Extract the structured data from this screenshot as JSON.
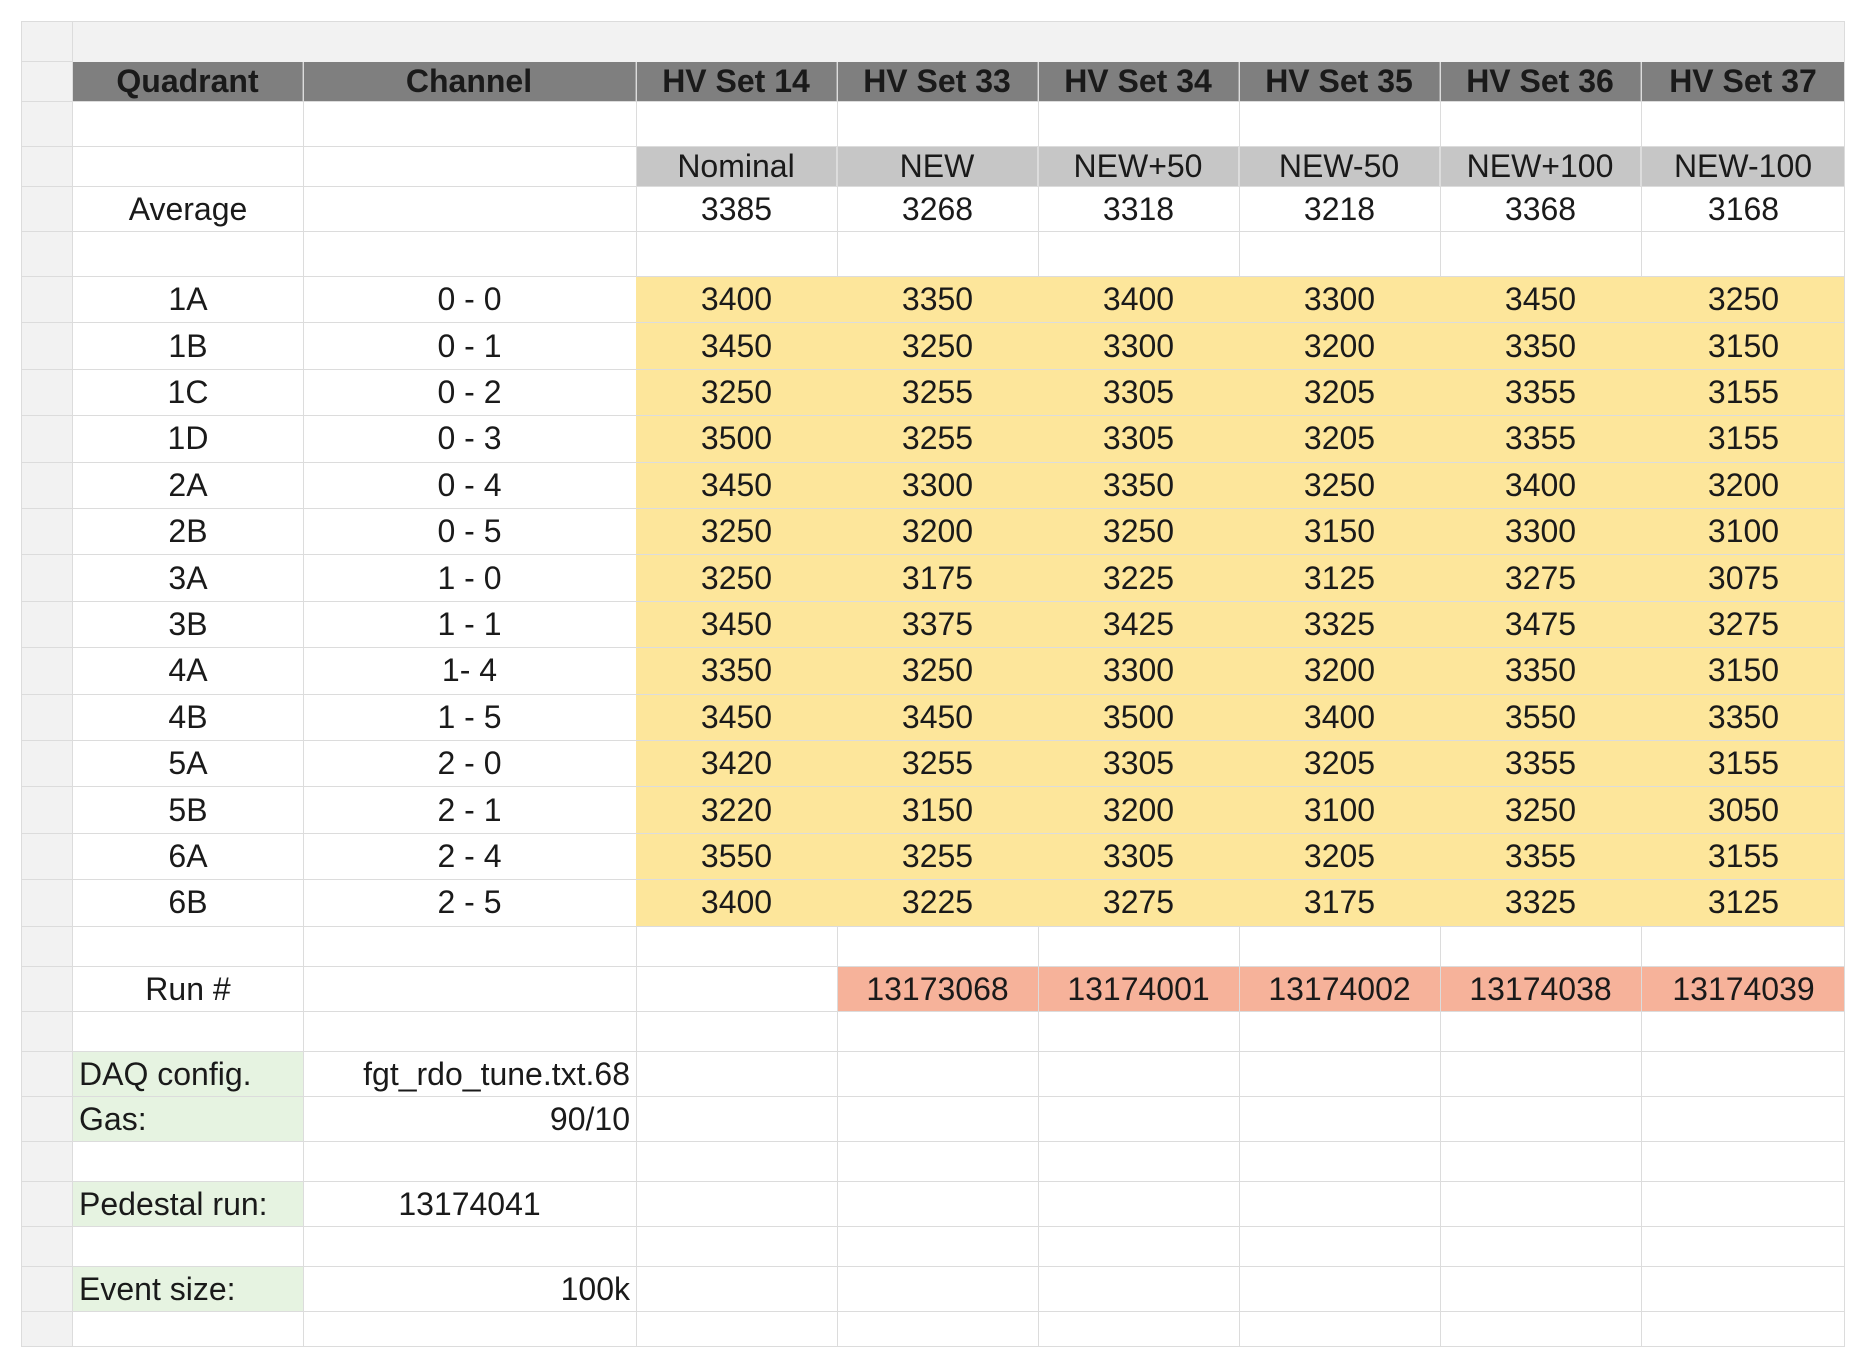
{
  "headers": [
    "Quadrant",
    "Channel",
    "HV Set 14",
    "HV Set 33",
    "HV Set 34",
    "HV Set 35",
    "HV Set 36",
    "HV Set 37"
  ],
  "subheaders": [
    "Nominal",
    "NEW",
    "NEW+50",
    "NEW-50",
    "NEW+100",
    "NEW-100"
  ],
  "average": {
    "label": "Average",
    "values": [
      "3385",
      "3268",
      "3318",
      "3218",
      "3368",
      "3168"
    ]
  },
  "rows": [
    {
      "quadrant": "1A",
      "channel": "0 - 0",
      "values": [
        "3400",
        "3350",
        "3400",
        "3300",
        "3450",
        "3250"
      ]
    },
    {
      "quadrant": "1B",
      "channel": "0 - 1",
      "values": [
        "3450",
        "3250",
        "3300",
        "3200",
        "3350",
        "3150"
      ]
    },
    {
      "quadrant": "1C",
      "channel": "0 - 2",
      "values": [
        "3250",
        "3255",
        "3305",
        "3205",
        "3355",
        "3155"
      ]
    },
    {
      "quadrant": "1D",
      "channel": "0 - 3",
      "values": [
        "3500",
        "3255",
        "3305",
        "3205",
        "3355",
        "3155"
      ]
    },
    {
      "quadrant": "2A",
      "channel": "0 - 4",
      "values": [
        "3450",
        "3300",
        "3350",
        "3250",
        "3400",
        "3200"
      ]
    },
    {
      "quadrant": "2B",
      "channel": "0 - 5",
      "values": [
        "3250",
        "3200",
        "3250",
        "3150",
        "3300",
        "3100"
      ]
    },
    {
      "quadrant": "3A",
      "channel": "1 - 0",
      "values": [
        "3250",
        "3175",
        "3225",
        "3125",
        "3275",
        "3075"
      ]
    },
    {
      "quadrant": "3B",
      "channel": "1 - 1",
      "values": [
        "3450",
        "3375",
        "3425",
        "3325",
        "3475",
        "3275"
      ]
    },
    {
      "quadrant": "4A",
      "channel": "1- 4",
      "values": [
        "3350",
        "3250",
        "3300",
        "3200",
        "3350",
        "3150"
      ]
    },
    {
      "quadrant": "4B",
      "channel": "1 - 5",
      "values": [
        "3450",
        "3450",
        "3500",
        "3400",
        "3550",
        "3350"
      ]
    },
    {
      "quadrant": "5A",
      "channel": "2 - 0",
      "values": [
        "3420",
        "3255",
        "3305",
        "3205",
        "3355",
        "3155"
      ]
    },
    {
      "quadrant": "5B",
      "channel": "2 - 1",
      "values": [
        "3220",
        "3150",
        "3200",
        "3100",
        "3250",
        "3050"
      ]
    },
    {
      "quadrant": "6A",
      "channel": "2 - 4",
      "values": [
        "3550",
        "3255",
        "3305",
        "3205",
        "3355",
        "3155"
      ]
    },
    {
      "quadrant": "6B",
      "channel": "2 - 5",
      "values": [
        "3400",
        "3225",
        "3275",
        "3175",
        "3325",
        "3125"
      ]
    }
  ],
  "run": {
    "label": "Run #",
    "values": [
      "13173068",
      "13174001",
      "13174002",
      "13174038",
      "13174039"
    ]
  },
  "info": {
    "daq_label": "DAQ config.",
    "daq_value": "fgt_rdo_tune.txt.68",
    "gas_label": "Gas:",
    "gas_value": "90/10",
    "pedestal_label": "Pedestal run:",
    "pedestal_value": "13174041",
    "event_label": "Event size:",
    "event_value": "100k"
  },
  "colors": {
    "header": "#7f7f7f",
    "subheader": "#c6c6c6",
    "data_fill": "#fde69b",
    "run_fill": "#f6b29a",
    "label_fill": "#e6f3e1"
  }
}
